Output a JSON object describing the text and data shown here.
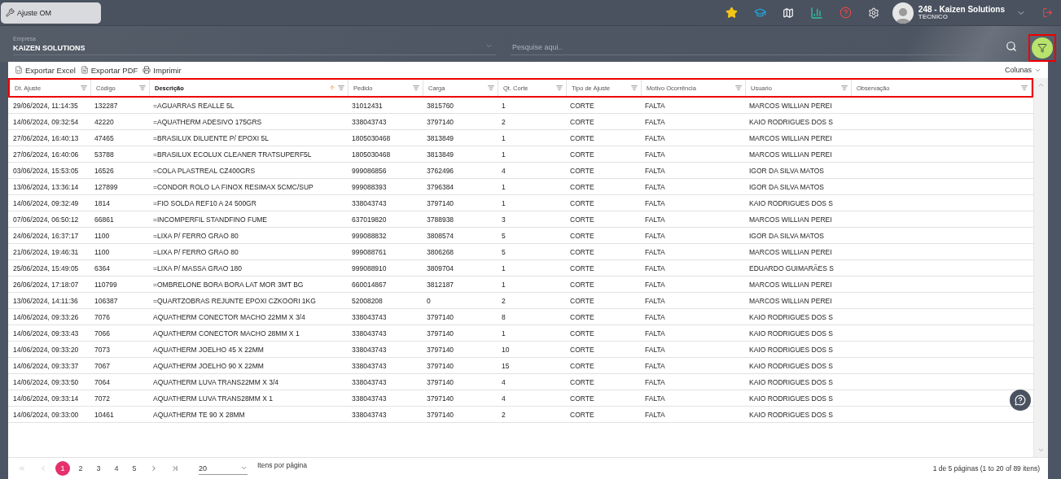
{
  "tab": {
    "label": "Ajuste OM",
    "selected": true
  },
  "user": {
    "name": "248 - Kaizen Solutions",
    "role": "TECNICO"
  },
  "empresa": {
    "label": "Empresa",
    "value": "KAIZEN SOLUTIONS"
  },
  "search": {
    "placeholder": "Pesquise aqui.."
  },
  "toolbar": [
    {
      "kind": "excel",
      "label": "Exportar Excel"
    },
    {
      "kind": "pdf",
      "label": "Exportar PDF"
    },
    {
      "kind": "print",
      "label": "Imprimir"
    }
  ],
  "columns_menu": "Colunas",
  "columns": [
    {
      "label": "Dt. Ajuste",
      "sorted": false
    },
    {
      "label": "Código",
      "sorted": false
    },
    {
      "label": "Descrição",
      "sorted": true
    },
    {
      "label": "Pedido",
      "sorted": false
    },
    {
      "label": "Carga",
      "sorted": false
    },
    {
      "label": "Qt. Corte",
      "sorted": false
    },
    {
      "label": "Tipo de Ajuste",
      "sorted": false
    },
    {
      "label": "Motivo Ocorrência",
      "sorted": false
    },
    {
      "label": "Usuario",
      "sorted": false
    },
    {
      "label": "Observação",
      "sorted": false
    }
  ],
  "rows": [
    [
      "29/06/2024, 11:14:35",
      "132287",
      "=AGUARRAS REALLE 5L",
      "31012431",
      "3815760",
      "1",
      "CORTE",
      "FALTA",
      "MARCOS WILLIAN PEREI"
    ],
    [
      "14/06/2024, 09:32:54",
      "42220",
      "=AQUATHERM ADESIVO 175GRS",
      "338043743",
      "3797140",
      "2",
      "CORTE",
      "FALTA",
      "KAIO RODRIGUES DOS S"
    ],
    [
      "27/06/2024, 16:40:13",
      "47465",
      "=BRASILUX DILUENTE P/ EPOXI 5L",
      "1805030468",
      "3813849",
      "1",
      "CORTE",
      "FALTA",
      "MARCOS WILLIAN PEREI"
    ],
    [
      "27/06/2024, 16:40:06",
      "53788",
      "=BRASILUX ECOLUX CLEANER TRATSUPERF5L",
      "1805030468",
      "3813849",
      "1",
      "CORTE",
      "FALTA",
      "MARCOS WILLIAN PEREI"
    ],
    [
      "03/06/2024, 15:53:05",
      "16526",
      "=COLA PLASTREAL CZ400GRS",
      "999086856",
      "3762496",
      "4",
      "CORTE",
      "FALTA",
      "IGOR DA SILVA MATOS"
    ],
    [
      "13/06/2024, 13:36:14",
      "127899",
      "=CONDOR ROLO LA FINOX RESIMAX 5CMC/SUP",
      "999088393",
      "3796384",
      "1",
      "CORTE",
      "FALTA",
      "IGOR DA SILVA MATOS"
    ],
    [
      "14/06/2024, 09:32:49",
      "1814",
      "=FIO SOLDA REF10 A 24 500GR",
      "338043743",
      "3797140",
      "1",
      "CORTE",
      "FALTA",
      "KAIO RODRIGUES DOS S"
    ],
    [
      "07/06/2024, 06:50:12",
      "66861",
      "=INCOMPERFIL STANDFINO FUME",
      "637019820",
      "3788938",
      "3",
      "CORTE",
      "FALTA",
      "MARCOS WILLIAN PEREI"
    ],
    [
      "24/06/2024, 16:37:17",
      "1100",
      "=LIXA P/ FERRO GRAO 80",
      "999088832",
      "3808574",
      "5",
      "CORTE",
      "FALTA",
      "IGOR DA SILVA MATOS"
    ],
    [
      "21/06/2024, 19:46:31",
      "1100",
      "=LIXA P/ FERRO GRAO 80",
      "999088761",
      "3806268",
      "5",
      "CORTE",
      "FALTA",
      "MARCOS WILLIAN PEREI"
    ],
    [
      "25/06/2024, 15:49:05",
      "6364",
      "=LIXA P/ MASSA GRAO 180",
      "999088910",
      "3809704",
      "1",
      "CORTE",
      "FALTA",
      "EDUARDO GUIMARÃES S"
    ],
    [
      "26/06/2024, 17:18:07",
      "110799",
      "=OMBRELONE BORA BORA LAT MOR 3MT BG",
      "660014867",
      "3812187",
      "1",
      "CORTE",
      "FALTA",
      "MARCOS WILLIAN PEREI"
    ],
    [
      "13/06/2024, 14:11:36",
      "106387",
      "=QUARTZOBRAS REJUNTE EPOXI CZKOORI 1KG",
      "52008208",
      "0",
      "2",
      "CORTE",
      "FALTA",
      "MARCOS WILLIAN PEREI"
    ],
    [
      "14/06/2024, 09:33:26",
      "7076",
      "AQUATHERM CONECTOR MACHO 22MM X 3/4",
      "338043743",
      "3797140",
      "8",
      "CORTE",
      "FALTA",
      "KAIO RODRIGUES DOS S"
    ],
    [
      "14/06/2024, 09:33:43",
      "7066",
      "AQUATHERM CONECTOR MACHO 28MM X 1",
      "338043743",
      "3797140",
      "1",
      "CORTE",
      "FALTA",
      "KAIO RODRIGUES DOS S"
    ],
    [
      "14/06/2024, 09:33:20",
      "7073",
      "AQUATHERM JOELHO 45 X 22MM",
      "338043743",
      "3797140",
      "10",
      "CORTE",
      "FALTA",
      "KAIO RODRIGUES DOS S"
    ],
    [
      "14/06/2024, 09:33:37",
      "7067",
      "AQUATHERM JOELHO 90 X 22MM",
      "338043743",
      "3797140",
      "15",
      "CORTE",
      "FALTA",
      "KAIO RODRIGUES DOS S"
    ],
    [
      "14/06/2024, 09:33:50",
      "7064",
      "AQUATHERM LUVA TRANS22MM X 3/4",
      "338043743",
      "3797140",
      "4",
      "CORTE",
      "FALTA",
      "KAIO RODRIGUES DOS S"
    ],
    [
      "14/06/2024, 09:33:14",
      "7072",
      "AQUATHERM LUVA TRANS28MM X 1",
      "338043743",
      "3797140",
      "4",
      "CORTE",
      "FALTA",
      "KAIO RODRIGUES DOS S"
    ],
    [
      "14/06/2024, 09:33:00",
      "10461",
      "AQUATHERM TE 90 X 28MM",
      "338043743",
      "3797140",
      "2",
      "CORTE",
      "FALTA",
      "KAIO RODRIGUES DOS S"
    ]
  ],
  "pagination": {
    "nav_before": [
      {
        "kind": "first",
        "disabled": true
      },
      {
        "kind": "prev",
        "disabled": true
      }
    ],
    "pages": [
      {
        "label": "1",
        "selected": true
      },
      {
        "label": "2",
        "selected": false
      },
      {
        "label": "3",
        "selected": false
      },
      {
        "label": "4",
        "selected": false
      },
      {
        "label": "5",
        "selected": false
      }
    ],
    "nav_after": [
      {
        "kind": "next",
        "disabled": false
      },
      {
        "kind": "last",
        "disabled": false
      }
    ],
    "page_size": "20",
    "page_size_label": "Itens por página",
    "summary": "1 de 5 páginas (1 to 20 of 89 itens)"
  }
}
